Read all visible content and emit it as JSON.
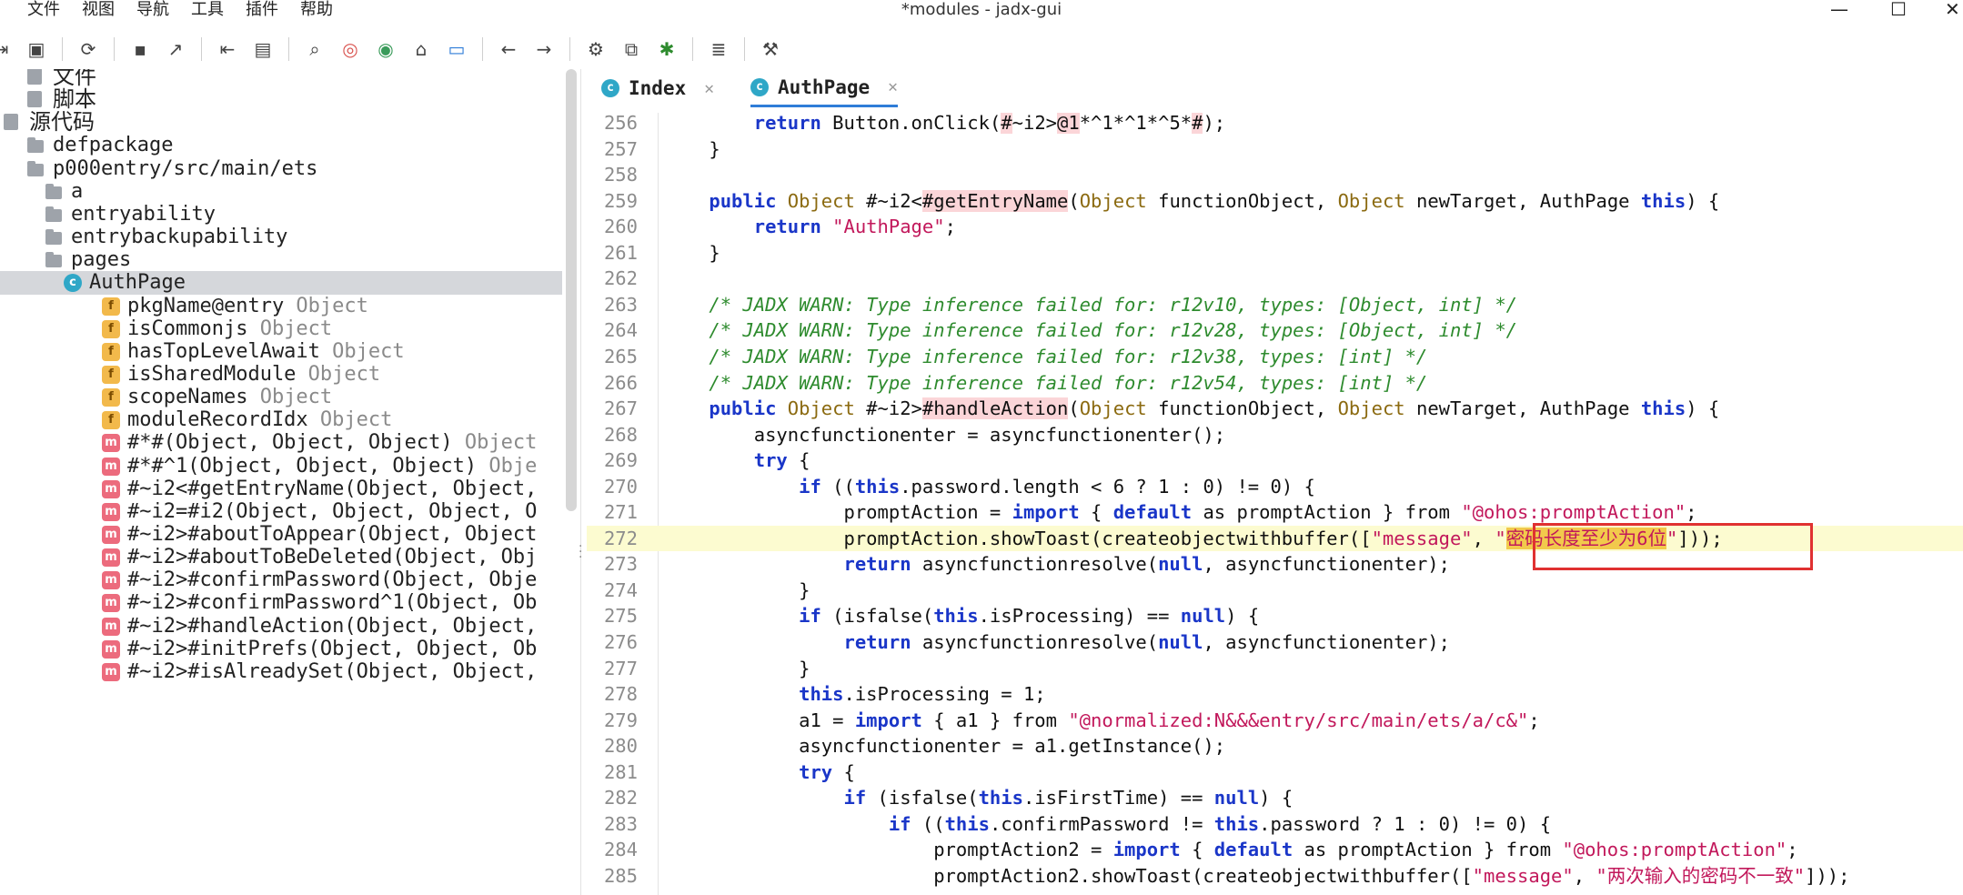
{
  "menu": [
    "文件",
    "视图",
    "导航",
    "工具",
    "插件",
    "帮助"
  ],
  "window": {
    "title": "*modules - jadx-gui",
    "min": "—",
    "max": "☐",
    "close": "✕"
  },
  "toolbar_icons": [
    "open-file-icon",
    "add-files-icon",
    "sep",
    "reload-icon",
    "sep",
    "save-icon",
    "export-icon",
    "sep",
    "sync-icon",
    "flatten-packages-icon",
    "sep",
    "search-icon",
    "find-class-icon",
    "find-usage-icon",
    "home-icon",
    "code-view-icon",
    "sep",
    "back-icon",
    "forward-icon",
    "sep",
    "deobfuscation-icon",
    "quark-icon",
    "debug-icon",
    "sep",
    "log-icon",
    "sep",
    "preferences-icon"
  ],
  "tree": {
    "rows": [
      {
        "chev": "›",
        "icon": "file",
        "label": "文件",
        "type": "",
        "cn": true,
        "depth": 0
      },
      {
        "chev": "",
        "icon": "file",
        "label": "脚本",
        "type": "",
        "cn": true,
        "depth": 0
      },
      {
        "chev": "",
        "icon": "file",
        "label": "源代码",
        "type": "",
        "cn": true,
        "depth": -1
      },
      {
        "chev": "›",
        "icon": "folder",
        "label": "defpackage",
        "type": "",
        "depth": 0
      },
      {
        "chev": "⌄",
        "icon": "folder",
        "label": "p000entry/src/main/ets",
        "type": "",
        "depth": 0
      },
      {
        "chev": "›",
        "icon": "folder",
        "label": "a",
        "type": "",
        "depth": 1
      },
      {
        "chev": "›",
        "icon": "folder",
        "label": "entryability",
        "type": "",
        "depth": 1
      },
      {
        "chev": "›",
        "icon": "folder",
        "label": "entrybackupability",
        "type": "",
        "depth": 1
      },
      {
        "chev": "⌄",
        "icon": "folder",
        "label": "pages",
        "type": "",
        "depth": 1
      },
      {
        "chev": "⌄",
        "icon": "class",
        "label": "AuthPage",
        "type": "",
        "depth": 2,
        "selected": true
      },
      {
        "chev": "",
        "icon": "field",
        "label": "pkgName@entry",
        "type": "Object",
        "depth": 3
      },
      {
        "chev": "",
        "icon": "field",
        "label": "isCommonjs",
        "type": "Object",
        "depth": 3
      },
      {
        "chev": "",
        "icon": "field",
        "label": "hasTopLevelAwait",
        "type": "Object",
        "depth": 3
      },
      {
        "chev": "",
        "icon": "field",
        "label": "isSharedModule",
        "type": "Object",
        "depth": 3
      },
      {
        "chev": "",
        "icon": "field",
        "label": "scopeNames",
        "type": "Object",
        "depth": 3
      },
      {
        "chev": "",
        "icon": "field",
        "label": "moduleRecordIdx",
        "type": "Object",
        "depth": 3
      },
      {
        "chev": "",
        "icon": "method",
        "label": "#*#(Object, Object, Object)",
        "type": "Object",
        "depth": 3
      },
      {
        "chev": "",
        "icon": "method",
        "label": "#*#^1(Object, Object, Object)",
        "type": "Obje",
        "depth": 3
      },
      {
        "chev": "",
        "icon": "method",
        "label": "#~i2<#getEntryName(Object, Object,",
        "type": "",
        "depth": 3
      },
      {
        "chev": "",
        "icon": "method",
        "label": "#~i2=#i2(Object, Object, Object, O",
        "type": "",
        "depth": 3
      },
      {
        "chev": "",
        "icon": "method",
        "label": "#~i2>#aboutToAppear(Object, Object",
        "type": "",
        "depth": 3
      },
      {
        "chev": "",
        "icon": "method",
        "label": "#~i2>#aboutToBeDeleted(Object, Obj",
        "type": "",
        "depth": 3
      },
      {
        "chev": "",
        "icon": "method",
        "label": "#~i2>#confirmPassword(Object, Obje",
        "type": "",
        "depth": 3
      },
      {
        "chev": "",
        "icon": "method",
        "label": "#~i2>#confirmPassword^1(Object, Ob",
        "type": "",
        "depth": 3
      },
      {
        "chev": "",
        "icon": "method",
        "label": "#~i2>#handleAction(Object, Object,",
        "type": "",
        "depth": 3
      },
      {
        "chev": "",
        "icon": "method",
        "label": "#~i2>#initPrefs(Object, Object, Ob",
        "type": "",
        "depth": 3
      },
      {
        "chev": "",
        "icon": "method",
        "label": "#~i2>#isAlreadySet(Object, Object,",
        "type": "",
        "depth": 3
      }
    ]
  },
  "tabs": [
    {
      "label": "Index",
      "close": "✕",
      "active": false
    },
    {
      "label": "AuthPage",
      "close": "✕",
      "active": true
    }
  ],
  "code": {
    "highlight_line": 272,
    "lines": [
      {
        "n": "256",
        "segs": [
          [
            "",
            "        "
          ],
          [
            "kw",
            "return"
          ],
          [
            "",
            " Button.onClick("
          ],
          [
            "mk",
            "#"
          ],
          [
            "",
            "~i2>"
          ],
          [
            "mk",
            "@1"
          ],
          [
            "",
            "*^1*^1*^5*"
          ],
          [
            "mk",
            "#"
          ],
          [
            "",
            ");"
          ]
        ]
      },
      {
        "n": "257",
        "segs": [
          [
            "",
            "    }"
          ]
        ]
      },
      {
        "n": "258",
        "segs": []
      },
      {
        "n": "259",
        "segs": [
          [
            "",
            "    "
          ],
          [
            "kw",
            "public"
          ],
          [
            "",
            " "
          ],
          [
            "ty",
            "Object"
          ],
          [
            "",
            " #~i2<"
          ],
          [
            "mk",
            "#getEntryName"
          ],
          [
            "",
            "("
          ],
          [
            "ty",
            "Object"
          ],
          [
            "",
            " functionObject, "
          ],
          [
            "ty",
            "Object"
          ],
          [
            "",
            " newTarget, AuthPage "
          ],
          [
            "kw",
            "this"
          ],
          [
            "",
            ") {"
          ]
        ]
      },
      {
        "n": "260",
        "segs": [
          [
            "",
            "        "
          ],
          [
            "kw",
            "return"
          ],
          [
            "",
            " "
          ],
          [
            "st",
            "\"AuthPage\""
          ],
          [
            "",
            ";"
          ]
        ]
      },
      {
        "n": "261",
        "segs": [
          [
            "",
            "    }"
          ]
        ]
      },
      {
        "n": "262",
        "segs": []
      },
      {
        "n": "263",
        "segs": [
          [
            "",
            "    "
          ],
          [
            "cm",
            "/* JADX WARN: Type inference failed for: r12v10, types: [Object, int] */"
          ]
        ]
      },
      {
        "n": "264",
        "segs": [
          [
            "",
            "    "
          ],
          [
            "cm",
            "/* JADX WARN: Type inference failed for: r12v28, types: [Object, int] */"
          ]
        ]
      },
      {
        "n": "265",
        "segs": [
          [
            "",
            "    "
          ],
          [
            "cm",
            "/* JADX WARN: Type inference failed for: r12v38, types: [int] */"
          ]
        ]
      },
      {
        "n": "266",
        "segs": [
          [
            "",
            "    "
          ],
          [
            "cm",
            "/* JADX WARN: Type inference failed for: r12v54, types: [int] */"
          ]
        ]
      },
      {
        "n": "267",
        "segs": [
          [
            "",
            "    "
          ],
          [
            "kw",
            "public"
          ],
          [
            "",
            " "
          ],
          [
            "ty",
            "Object"
          ],
          [
            "",
            " #~i2>"
          ],
          [
            "mk",
            "#handleAction"
          ],
          [
            "",
            "("
          ],
          [
            "ty",
            "Object"
          ],
          [
            "",
            " functionObject, "
          ],
          [
            "ty",
            "Object"
          ],
          [
            "",
            " newTarget, AuthPage "
          ],
          [
            "kw",
            "this"
          ],
          [
            "",
            ") {"
          ]
        ]
      },
      {
        "n": "268",
        "segs": [
          [
            "",
            "        asyncfunctionenter = asyncfunctionenter();"
          ]
        ]
      },
      {
        "n": "269",
        "segs": [
          [
            "",
            "        "
          ],
          [
            "kw",
            "try"
          ],
          [
            "",
            " {"
          ]
        ]
      },
      {
        "n": "270",
        "segs": [
          [
            "",
            "            "
          ],
          [
            "kw",
            "if"
          ],
          [
            "",
            " (("
          ],
          [
            "kw",
            "this"
          ],
          [
            "",
            ".password.length < 6 ? 1 : 0) != 0) {"
          ]
        ]
      },
      {
        "n": "271",
        "segs": [
          [
            "",
            "                promptAction = "
          ],
          [
            "kw",
            "import"
          ],
          [
            "",
            " { "
          ],
          [
            "kw",
            "default"
          ],
          [
            "",
            " as promptAction } from "
          ],
          [
            "st",
            "\"@ohos:promptAction\""
          ],
          [
            "",
            ";"
          ]
        ]
      },
      {
        "n": "272",
        "segs": [
          [
            "",
            "                promptAction.showToast(createobjectwithbuffer(["
          ],
          [
            "st",
            "\"message\""
          ],
          [
            "",
            ", "
          ],
          [
            "st",
            "\""
          ],
          [
            "selbg",
            "密码长度至少为6位"
          ],
          [
            "st",
            "\""
          ],
          [
            "",
            "]));"
          ]
        ]
      },
      {
        "n": "273",
        "segs": [
          [
            "",
            "                "
          ],
          [
            "kw",
            "return"
          ],
          [
            "",
            " asyncfunctionresolve("
          ],
          [
            "kw",
            "null"
          ],
          [
            "",
            ", asyncfunctionenter);"
          ]
        ]
      },
      {
        "n": "274",
        "segs": [
          [
            "",
            "            }"
          ]
        ]
      },
      {
        "n": "275",
        "segs": [
          [
            "",
            "            "
          ],
          [
            "kw",
            "if"
          ],
          [
            "",
            " (isfalse("
          ],
          [
            "kw",
            "this"
          ],
          [
            "",
            ".isProcessing) == "
          ],
          [
            "kw",
            "null"
          ],
          [
            "",
            ") {"
          ]
        ]
      },
      {
        "n": "276",
        "segs": [
          [
            "",
            "                "
          ],
          [
            "kw",
            "return"
          ],
          [
            "",
            " asyncfunctionresolve("
          ],
          [
            "kw",
            "null"
          ],
          [
            "",
            ", asyncfunctionenter);"
          ]
        ]
      },
      {
        "n": "277",
        "segs": [
          [
            "",
            "            }"
          ]
        ]
      },
      {
        "n": "278",
        "segs": [
          [
            "",
            "            "
          ],
          [
            "kw",
            "this"
          ],
          [
            "",
            ".isProcessing = 1;"
          ]
        ]
      },
      {
        "n": "279",
        "segs": [
          [
            "",
            "            a1 = "
          ],
          [
            "kw",
            "import"
          ],
          [
            "",
            " { a1 } from "
          ],
          [
            "st",
            "\"@normalized:N&&&entry/src/main/ets/a/c&\""
          ],
          [
            "",
            ";"
          ]
        ]
      },
      {
        "n": "280",
        "segs": [
          [
            "",
            "            asyncfunctionenter = a1.getInstance();"
          ]
        ]
      },
      {
        "n": "281",
        "segs": [
          [
            "",
            "            "
          ],
          [
            "kw",
            "try"
          ],
          [
            "",
            " {"
          ]
        ]
      },
      {
        "n": "282",
        "segs": [
          [
            "",
            "                "
          ],
          [
            "kw",
            "if"
          ],
          [
            "",
            " (isfalse("
          ],
          [
            "kw",
            "this"
          ],
          [
            "",
            ".isFirstTime) == "
          ],
          [
            "kw",
            "null"
          ],
          [
            "",
            ") {"
          ]
        ]
      },
      {
        "n": "283",
        "segs": [
          [
            "",
            "                    "
          ],
          [
            "kw",
            "if"
          ],
          [
            "",
            " (("
          ],
          [
            "kw",
            "this"
          ],
          [
            "",
            ".confirmPassword != "
          ],
          [
            "kw",
            "this"
          ],
          [
            "",
            ".password ? 1 : 0) != 0) {"
          ]
        ]
      },
      {
        "n": "284",
        "segs": [
          [
            "",
            "                        promptAction2 = "
          ],
          [
            "kw",
            "import"
          ],
          [
            "",
            " { "
          ],
          [
            "kw",
            "default"
          ],
          [
            "",
            " as promptAction } from "
          ],
          [
            "st",
            "\"@ohos:promptAction\""
          ],
          [
            "",
            ";"
          ]
        ]
      },
      {
        "n": "285",
        "segs": [
          [
            "",
            "                        promptAction2.showToast(createobjectwithbuffer(["
          ],
          [
            "st",
            "\"message\""
          ],
          [
            "",
            ", "
          ],
          [
            "st",
            "\"两次输入的密码不一致\""
          ],
          [
            "",
            "]));"
          ]
        ]
      }
    ]
  }
}
